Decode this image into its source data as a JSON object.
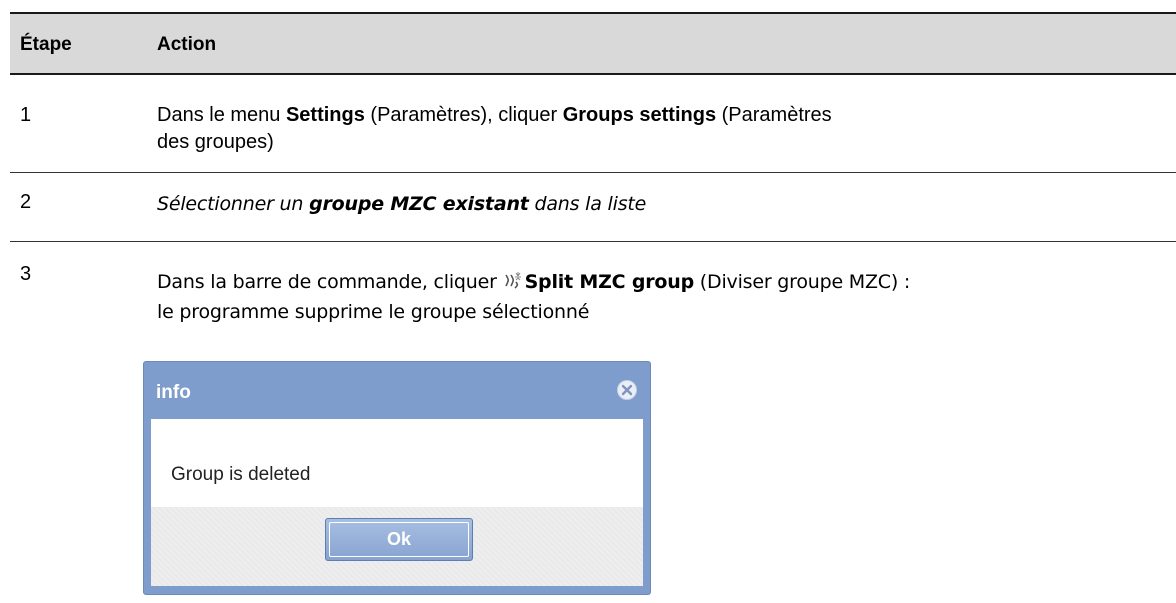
{
  "table": {
    "header": {
      "col_step": "Étape",
      "col_action": "Action"
    },
    "rows": [
      {
        "step": "1",
        "action_parts": [
          "Dans le menu ",
          "Settings",
          " (Paramètres), cliquer ",
          "Groups settings",
          " (Paramètres",
          "des groupes)"
        ]
      },
      {
        "step": "2",
        "action_parts": [
          "Sélectionner un ",
          "groupe MZC existant",
          " dans la liste"
        ]
      },
      {
        "step": "3",
        "action_parts": [
          "Dans la barre de commande, cliquer ",
          "Split MZC group",
          " (Diviser groupe MZC) :",
          "le programme supprime le groupe sélectionné"
        ],
        "icon": "split-icon"
      }
    ]
  },
  "dialog": {
    "title": "info",
    "message": "Group is deleted",
    "ok_label": "Ok",
    "close_icon": "close-icon",
    "colors": {
      "frame": "#7e9dcc",
      "button": "#8ea9d4"
    }
  }
}
